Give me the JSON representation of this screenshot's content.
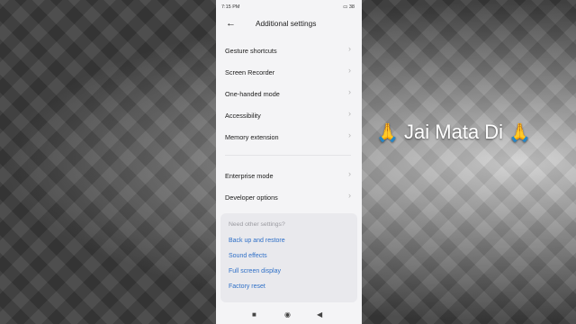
{
  "status_bar": {
    "time": "7:15 PM",
    "battery": "38"
  },
  "header": {
    "back_icon": "←",
    "title": "Additional settings"
  },
  "settings": {
    "group1": [
      "Gesture shortcuts",
      "Screen Recorder",
      "One-handed mode",
      "Accessibility",
      "Memory extension"
    ],
    "group2": [
      "Enterprise mode",
      "Developer options"
    ],
    "chevron": "›"
  },
  "other_card": {
    "hint": "Need other settings?",
    "links": [
      "Back up and restore",
      "Sound effects",
      "Full screen display",
      "Factory reset"
    ]
  },
  "nav_bar": {
    "recent": "■",
    "home": "◉",
    "back": "◀"
  },
  "overlay": {
    "text": "Jai Mata Di",
    "emoji": "🙏"
  },
  "colors": {
    "link": "#2e6fc7",
    "background": "#f4f4f6"
  }
}
